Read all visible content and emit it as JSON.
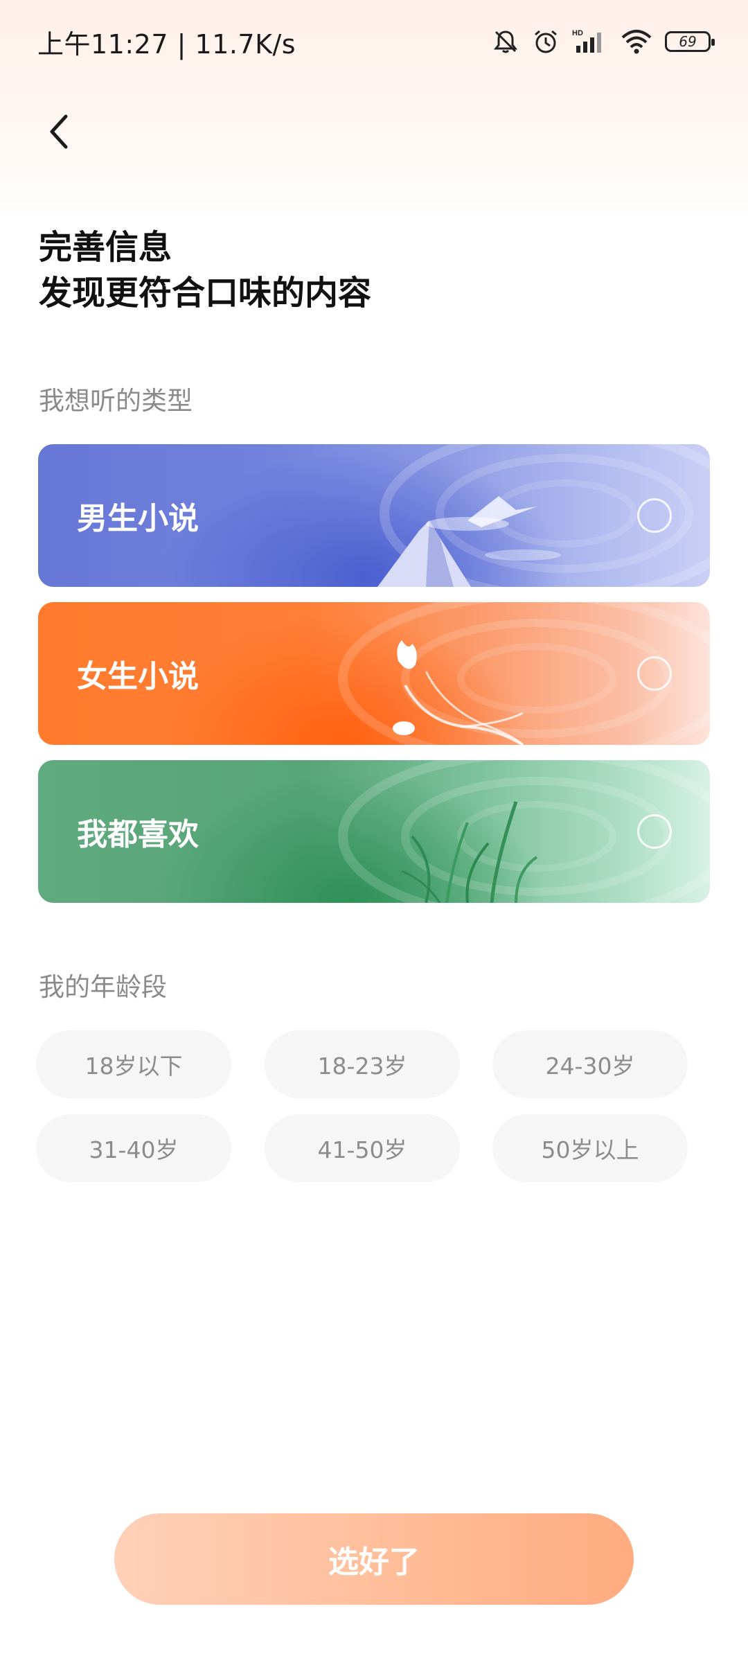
{
  "status_bar": {
    "time_and_speed": "上午11:27 | 11.7K/s",
    "battery_level": "69",
    "icons": [
      "bell-off-icon",
      "alarm-icon",
      "signal-hd-icon",
      "wifi-icon",
      "battery-icon"
    ]
  },
  "header": {
    "back_icon": "chevron-left-icon",
    "title_line1": "完善信息",
    "title_line2": "发现更符合口味的内容"
  },
  "genre_section": {
    "label": "我想听的类型",
    "options": [
      {
        "label": "男生小说",
        "selected": false,
        "color": "#6677d6",
        "art": "mountain"
      },
      {
        "label": "女生小说",
        "selected": false,
        "color": "#ff7a2d",
        "art": "tulip"
      },
      {
        "label": "我都喜欢",
        "selected": false,
        "color": "#5faa7e",
        "art": "grass"
      }
    ]
  },
  "age_section": {
    "label": "我的年龄段",
    "options": [
      "18岁以下",
      "18-23岁",
      "24-30岁",
      "31-40岁",
      "41-50岁",
      "50岁以上"
    ]
  },
  "confirm_button": {
    "label": "选好了",
    "enabled": false,
    "color": "#ffb48b"
  }
}
